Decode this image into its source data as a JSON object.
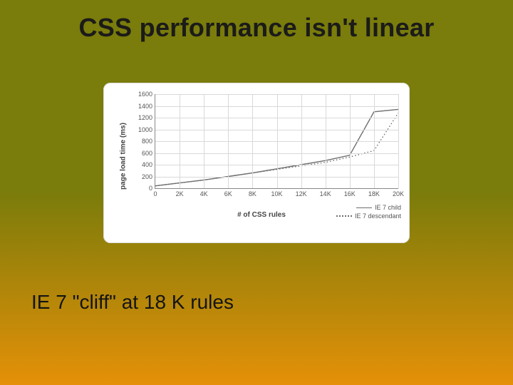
{
  "title": "CSS performance isn't linear",
  "caption": "IE 7 \"cliff\" at 18 K rules",
  "chart_data": {
    "type": "line",
    "title": "",
    "xlabel": "# of CSS rules",
    "ylabel": "page load time (ms)",
    "xlim": [
      0,
      20000
    ],
    "ylim": [
      0,
      1600
    ],
    "x": [
      0,
      2000,
      4000,
      6000,
      8000,
      10000,
      12000,
      14000,
      16000,
      18000,
      20000
    ],
    "x_tick_labels": [
      "0",
      "2K",
      "4K",
      "6K",
      "8K",
      "10K",
      "12K",
      "14K",
      "16K",
      "18K",
      "20K"
    ],
    "y_ticks": [
      0,
      200,
      400,
      600,
      800,
      1000,
      1200,
      1400,
      1600
    ],
    "series": [
      {
        "name": "IE 7 child",
        "style": "solid",
        "values": [
          40,
          90,
          140,
          200,
          260,
          330,
          400,
          470,
          560,
          1300,
          1340
        ]
      },
      {
        "name": "IE 7 descendant",
        "style": "dotted",
        "values": [
          40,
          90,
          140,
          200,
          260,
          320,
          380,
          440,
          530,
          640,
          1280
        ]
      }
    ]
  }
}
